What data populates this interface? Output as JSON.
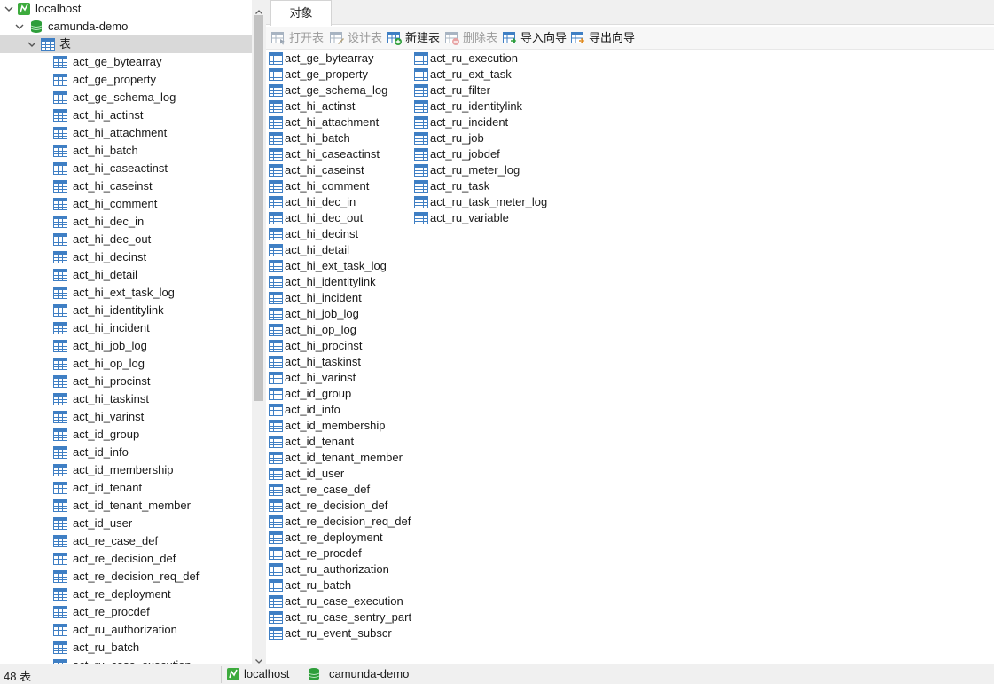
{
  "tree": {
    "connection": "localhost",
    "database": "camunda-demo",
    "tables_node": "表",
    "tables": [
      "act_ge_bytearray",
      "act_ge_property",
      "act_ge_schema_log",
      "act_hi_actinst",
      "act_hi_attachment",
      "act_hi_batch",
      "act_hi_caseactinst",
      "act_hi_caseinst",
      "act_hi_comment",
      "act_hi_dec_in",
      "act_hi_dec_out",
      "act_hi_decinst",
      "act_hi_detail",
      "act_hi_ext_task_log",
      "act_hi_identitylink",
      "act_hi_incident",
      "act_hi_job_log",
      "act_hi_op_log",
      "act_hi_procinst",
      "act_hi_taskinst",
      "act_hi_varinst",
      "act_id_group",
      "act_id_info",
      "act_id_membership",
      "act_id_tenant",
      "act_id_tenant_member",
      "act_id_user",
      "act_re_case_def",
      "act_re_decision_def",
      "act_re_decision_req_def",
      "act_re_deployment",
      "act_re_procdef",
      "act_ru_authorization",
      "act_ru_batch",
      "act_ru_case_execution"
    ]
  },
  "tab": {
    "label": "对象"
  },
  "toolbar": {
    "open_table": "打开表",
    "design_table": "设计表",
    "new_table": "新建表",
    "delete_table": "删除表",
    "import_wizard": "导入向导",
    "export_wizard": "导出向导"
  },
  "objects": {
    "column1": [
      "act_ge_bytearray",
      "act_ge_property",
      "act_ge_schema_log",
      "act_hi_actinst",
      "act_hi_attachment",
      "act_hi_batch",
      "act_hi_caseactinst",
      "act_hi_caseinst",
      "act_hi_comment",
      "act_hi_dec_in",
      "act_hi_dec_out",
      "act_hi_decinst",
      "act_hi_detail",
      "act_hi_ext_task_log",
      "act_hi_identitylink",
      "act_hi_incident",
      "act_hi_job_log",
      "act_hi_op_log",
      "act_hi_procinst",
      "act_hi_taskinst",
      "act_hi_varinst",
      "act_id_group",
      "act_id_info",
      "act_id_membership",
      "act_id_tenant",
      "act_id_tenant_member",
      "act_id_user",
      "act_re_case_def",
      "act_re_decision_def",
      "act_re_decision_req_def",
      "act_re_deployment",
      "act_re_procdef",
      "act_ru_authorization",
      "act_ru_batch",
      "act_ru_case_execution",
      "act_ru_case_sentry_part",
      "act_ru_event_subscr"
    ],
    "column2": [
      "act_ru_execution",
      "act_ru_ext_task",
      "act_ru_filter",
      "act_ru_identitylink",
      "act_ru_incident",
      "act_ru_job",
      "act_ru_jobdef",
      "act_ru_meter_log",
      "act_ru_task",
      "act_ru_task_meter_log",
      "act_ru_variable"
    ]
  },
  "statusbar": {
    "count": "48 表",
    "connection": "localhost",
    "database": "camunda-demo"
  },
  "colors": {
    "table_icon": "#3f7fc4",
    "connection_icon": "#3dab3d",
    "database_icon": "#2e9e3a",
    "selected_row": "#d9d9d9"
  }
}
